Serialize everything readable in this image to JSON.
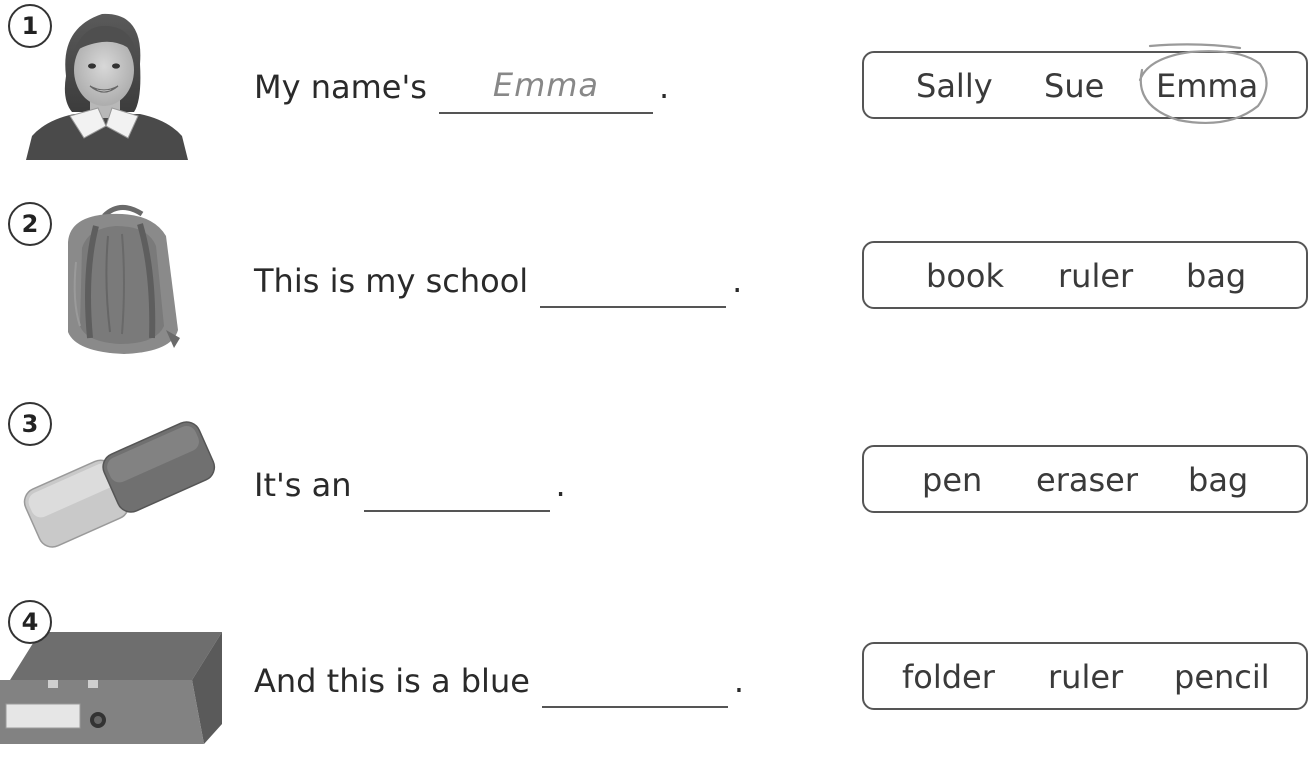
{
  "exercises": [
    {
      "number": "1",
      "picture": "girl-photo",
      "sentence_before": "My name's",
      "answer": "Emma",
      "sentence_after": ".",
      "options": [
        "Sally",
        "Sue",
        "Emma"
      ],
      "circled_option": "Emma"
    },
    {
      "number": "2",
      "picture": "backpack-photo",
      "sentence_before": "This is my school",
      "answer": "",
      "sentence_after": ".",
      "options": [
        "book",
        "ruler",
        "bag"
      ]
    },
    {
      "number": "3",
      "picture": "eraser-photo",
      "sentence_before": "It's an",
      "answer": "",
      "sentence_after": ".",
      "options": [
        "pen",
        "eraser",
        "bag"
      ]
    },
    {
      "number": "4",
      "picture": "folder-photo",
      "sentence_before": "And this is a blue",
      "answer": "",
      "sentence_after": ".",
      "options": [
        "folder",
        "ruler",
        "pencil"
      ]
    }
  ]
}
